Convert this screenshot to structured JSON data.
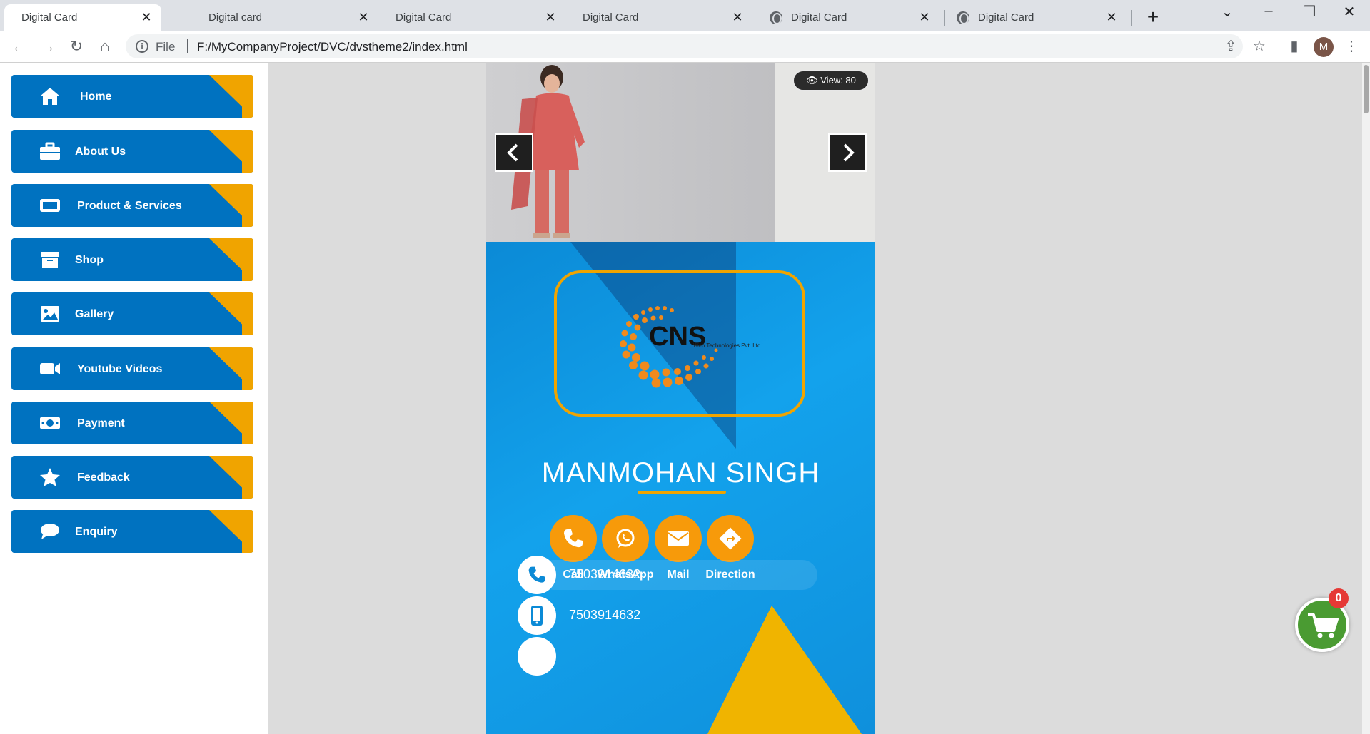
{
  "tabs": [
    {
      "title": "Digital Card",
      "icon": "site-logo-icon",
      "active": true
    },
    {
      "title": "Digital card",
      "icon": "site-logo-icon",
      "active": false
    },
    {
      "title": "Digital Card",
      "icon": "site-logo-icon",
      "active": false
    },
    {
      "title": "Digital Card",
      "icon": "site-logo-icon",
      "active": false
    },
    {
      "title": "Digital Card",
      "icon": "globe-icon",
      "active": false
    },
    {
      "title": "Digital Card",
      "icon": "globe-icon",
      "active": false
    }
  ],
  "toolbar": {
    "scheme": "File",
    "url": "F:/MyCompanyProject/DVC/dvstheme2/index.html",
    "avatar_initial": "M"
  },
  "sidebar": {
    "items": [
      {
        "label": "Home",
        "icon": "home-icon"
      },
      {
        "label": "About Us",
        "icon": "briefcase-icon"
      },
      {
        "label": "Product & Services",
        "icon": "card-icon"
      },
      {
        "label": "Shop",
        "icon": "archive-box-icon"
      },
      {
        "label": "Gallery",
        "icon": "image-icon"
      },
      {
        "label": "Youtube Videos",
        "icon": "video-camera-icon"
      },
      {
        "label": "Payment",
        "icon": "money-icon"
      },
      {
        "label": "Feedback",
        "icon": "star-icon"
      },
      {
        "label": "Enquiry",
        "icon": "chat-bubble-icon"
      }
    ]
  },
  "card": {
    "view_count": "View: 80",
    "logo_text": "CNS",
    "logo_subtext": "Web Technologies Pvt. Ltd.",
    "name": "MANMOHAN SINGH",
    "actions": [
      {
        "label": "Call",
        "icon": "phone-icon"
      },
      {
        "label": "WhatsApp",
        "icon": "whatsapp-icon"
      },
      {
        "label": "Mail",
        "icon": "envelope-icon"
      },
      {
        "label": "Direction",
        "icon": "direction-icon"
      }
    ],
    "contacts": [
      {
        "value": "7503914632",
        "icon": "phone-icon"
      },
      {
        "value": "7503914632",
        "icon": "mobile-icon"
      }
    ]
  },
  "cart": {
    "count": "0"
  },
  "colors": {
    "menu_blue": "#0072c0",
    "menu_accent": "#f0a400",
    "card_blue": "#1296e0",
    "action_orange": "#f79a0a",
    "cart_green": "#4a9b32",
    "badge_red": "#e53935"
  }
}
